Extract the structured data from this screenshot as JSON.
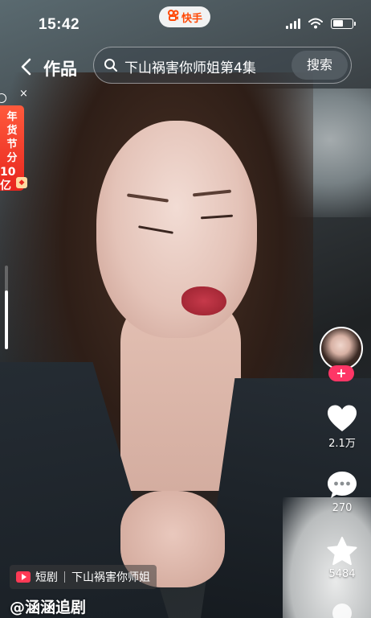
{
  "status_bar": {
    "time": "15:42",
    "brand_name": "快手"
  },
  "nav": {
    "title": "作品",
    "search_query": "下山祸害你师姐第4集",
    "search_button": "搜索"
  },
  "promo": {
    "lines": [
      "年",
      "货",
      "节",
      "分"
    ],
    "amount": "10亿",
    "close": "×"
  },
  "progress": {
    "fraction": 0.7
  },
  "actions": {
    "follow": "+",
    "likes": "2.1万",
    "comments": "270",
    "favorites": "5484"
  },
  "bottom": {
    "tag_type": "短剧",
    "series_title": "下山祸害你师姐",
    "author": "@涵涵追剧"
  }
}
